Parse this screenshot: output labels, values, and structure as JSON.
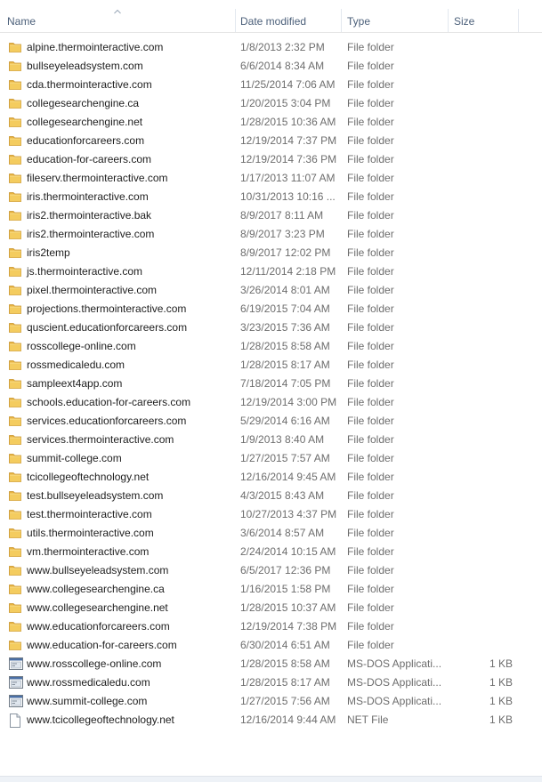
{
  "columns": {
    "name": "Name",
    "date": "Date modified",
    "type": "Type",
    "size": "Size"
  },
  "sort": {
    "column": "name",
    "direction": "ascending"
  },
  "colors": {
    "folder": "#e8b33f",
    "header_text": "#4c607a",
    "detail_text": "#6d6d6d"
  },
  "files": [
    {
      "name": "alpine.thermointeractive.com",
      "date": "1/8/2013 2:32 PM",
      "type": "File folder",
      "size": "",
      "icon": "folder-icon"
    },
    {
      "name": "bullseyeleadsystem.com",
      "date": "6/6/2014 8:34 AM",
      "type": "File folder",
      "size": "",
      "icon": "folder-icon"
    },
    {
      "name": "cda.thermointeractive.com",
      "date": "11/25/2014 7:06 AM",
      "type": "File folder",
      "size": "",
      "icon": "folder-icon"
    },
    {
      "name": "collegesearchengine.ca",
      "date": "1/20/2015 3:04 PM",
      "type": "File folder",
      "size": "",
      "icon": "folder-icon"
    },
    {
      "name": "collegesearchengine.net",
      "date": "1/28/2015 10:36 AM",
      "type": "File folder",
      "size": "",
      "icon": "folder-icon"
    },
    {
      "name": "educationforcareers.com",
      "date": "12/19/2014 7:37 PM",
      "type": "File folder",
      "size": "",
      "icon": "folder-icon"
    },
    {
      "name": "education-for-careers.com",
      "date": "12/19/2014 7:36 PM",
      "type": "File folder",
      "size": "",
      "icon": "folder-icon"
    },
    {
      "name": "fileserv.thermointeractive.com",
      "date": "1/17/2013 11:07 AM",
      "type": "File folder",
      "size": "",
      "icon": "folder-icon"
    },
    {
      "name": "iris.thermointeractive.com",
      "date": "10/31/2013 10:16 ...",
      "type": "File folder",
      "size": "",
      "icon": "folder-icon"
    },
    {
      "name": "iris2.thermointeractive.bak",
      "date": "8/9/2017 8:11 AM",
      "type": "File folder",
      "size": "",
      "icon": "folder-icon"
    },
    {
      "name": "iris2.thermointeractive.com",
      "date": "8/9/2017 3:23 PM",
      "type": "File folder",
      "size": "",
      "icon": "folder-icon"
    },
    {
      "name": "iris2temp",
      "date": "8/9/2017 12:02 PM",
      "type": "File folder",
      "size": "",
      "icon": "folder-icon"
    },
    {
      "name": "js.thermointeractive.com",
      "date": "12/11/2014 2:18 PM",
      "type": "File folder",
      "size": "",
      "icon": "folder-icon"
    },
    {
      "name": "pixel.thermointeractive.com",
      "date": "3/26/2014 8:01 AM",
      "type": "File folder",
      "size": "",
      "icon": "folder-icon"
    },
    {
      "name": "projections.thermointeractive.com",
      "date": "6/19/2015 7:04 AM",
      "type": "File folder",
      "size": "",
      "icon": "folder-icon"
    },
    {
      "name": "quscient.educationforcareers.com",
      "date": "3/23/2015 7:36 AM",
      "type": "File folder",
      "size": "",
      "icon": "folder-icon"
    },
    {
      "name": "rosscollege-online.com",
      "date": "1/28/2015 8:58 AM",
      "type": "File folder",
      "size": "",
      "icon": "folder-icon"
    },
    {
      "name": "rossmedicaledu.com",
      "date": "1/28/2015 8:17 AM",
      "type": "File folder",
      "size": "",
      "icon": "folder-icon"
    },
    {
      "name": "sampleext4app.com",
      "date": "7/18/2014 7:05 PM",
      "type": "File folder",
      "size": "",
      "icon": "folder-icon"
    },
    {
      "name": "schools.education-for-careers.com",
      "date": "12/19/2014 3:00 PM",
      "type": "File folder",
      "size": "",
      "icon": "folder-icon"
    },
    {
      "name": "services.educationforcareers.com",
      "date": "5/29/2014 6:16 AM",
      "type": "File folder",
      "size": "",
      "icon": "folder-icon"
    },
    {
      "name": "services.thermointeractive.com",
      "date": "1/9/2013 8:40 AM",
      "type": "File folder",
      "size": "",
      "icon": "folder-icon"
    },
    {
      "name": "summit-college.com",
      "date": "1/27/2015 7:57 AM",
      "type": "File folder",
      "size": "",
      "icon": "folder-icon"
    },
    {
      "name": "tcicollegeoftechnology.net",
      "date": "12/16/2014 9:45 AM",
      "type": "File folder",
      "size": "",
      "icon": "folder-icon"
    },
    {
      "name": "test.bullseyeleadsystem.com",
      "date": "4/3/2015 8:43 AM",
      "type": "File folder",
      "size": "",
      "icon": "folder-icon"
    },
    {
      "name": "test.thermointeractive.com",
      "date": "10/27/2013 4:37 PM",
      "type": "File folder",
      "size": "",
      "icon": "folder-icon"
    },
    {
      "name": "utils.thermointeractive.com",
      "date": "3/6/2014 8:57 AM",
      "type": "File folder",
      "size": "",
      "icon": "folder-icon"
    },
    {
      "name": "vm.thermointeractive.com",
      "date": "2/24/2014 10:15 AM",
      "type": "File folder",
      "size": "",
      "icon": "folder-icon"
    },
    {
      "name": "www.bullseyeleadsystem.com",
      "date": "6/5/2017 12:36 PM",
      "type": "File folder",
      "size": "",
      "icon": "folder-icon"
    },
    {
      "name": "www.collegesearchengine.ca",
      "date": "1/16/2015 1:58 PM",
      "type": "File folder",
      "size": "",
      "icon": "folder-icon"
    },
    {
      "name": "www.collegesearchengine.net",
      "date": "1/28/2015 10:37 AM",
      "type": "File folder",
      "size": "",
      "icon": "folder-icon"
    },
    {
      "name": "www.educationforcareers.com",
      "date": "12/19/2014 7:38 PM",
      "type": "File folder",
      "size": "",
      "icon": "folder-icon"
    },
    {
      "name": "www.education-for-careers.com",
      "date": "6/30/2014 6:51 AM",
      "type": "File folder",
      "size": "",
      "icon": "folder-icon"
    },
    {
      "name": "www.rosscollege-online.com",
      "date": "1/28/2015 8:58 AM",
      "type": "MS-DOS Applicati...",
      "size": "1 KB",
      "icon": "msdos-app-icon"
    },
    {
      "name": "www.rossmedicaledu.com",
      "date": "1/28/2015 8:17 AM",
      "type": "MS-DOS Applicati...",
      "size": "1 KB",
      "icon": "msdos-app-icon"
    },
    {
      "name": "www.summit-college.com",
      "date": "1/27/2015 7:56 AM",
      "type": "MS-DOS Applicati...",
      "size": "1 KB",
      "icon": "msdos-app-icon"
    },
    {
      "name": "www.tcicollegeoftechnology.net",
      "date": "12/16/2014 9:44 AM",
      "type": "NET File",
      "size": "1 KB",
      "icon": "blank-file-icon"
    }
  ]
}
